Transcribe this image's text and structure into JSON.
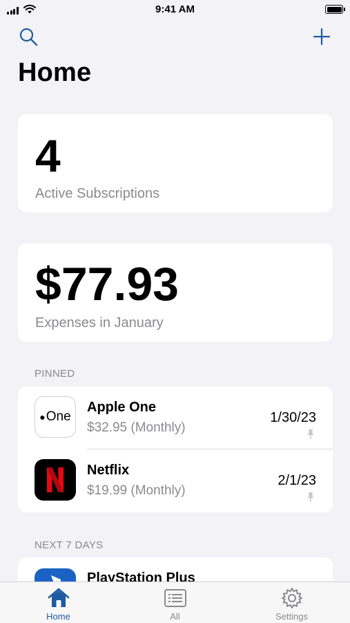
{
  "status_bar": {
    "time": "9:41 AM"
  },
  "header": {
    "title": "Home"
  },
  "summary": {
    "active_count": "4",
    "active_label": "Active Subscriptions",
    "expense_amount": "$77.93",
    "expense_label": "Expenses in January"
  },
  "sections": {
    "pinned": "PINNED",
    "next_7_days": "NEXT 7 DAYS"
  },
  "pinned": [
    {
      "icon": "apple-one-icon",
      "icon_text": "One",
      "name": "Apple One",
      "price": "$32.95 (Monthly)",
      "date": "1/30/23"
    },
    {
      "icon": "netflix-icon",
      "name": "Netflix",
      "price": "$19.99 (Monthly)",
      "date": "2/1/23"
    }
  ],
  "upcoming": [
    {
      "icon": "playstation-icon",
      "name": "PlayStation Plus"
    }
  ],
  "tabs": [
    {
      "label": "Home",
      "icon": "house-icon",
      "selected": true
    },
    {
      "label": "All",
      "icon": "list-icon",
      "selected": false
    },
    {
      "label": "Settings",
      "icon": "gear-icon",
      "selected": false
    }
  ],
  "colors": {
    "accent": "#1e5aa0",
    "background": "#f2f2f7",
    "secondary_text": "#8a8a8e",
    "netflix_red": "#e50914",
    "playstation_blue": "#1a63c4"
  }
}
